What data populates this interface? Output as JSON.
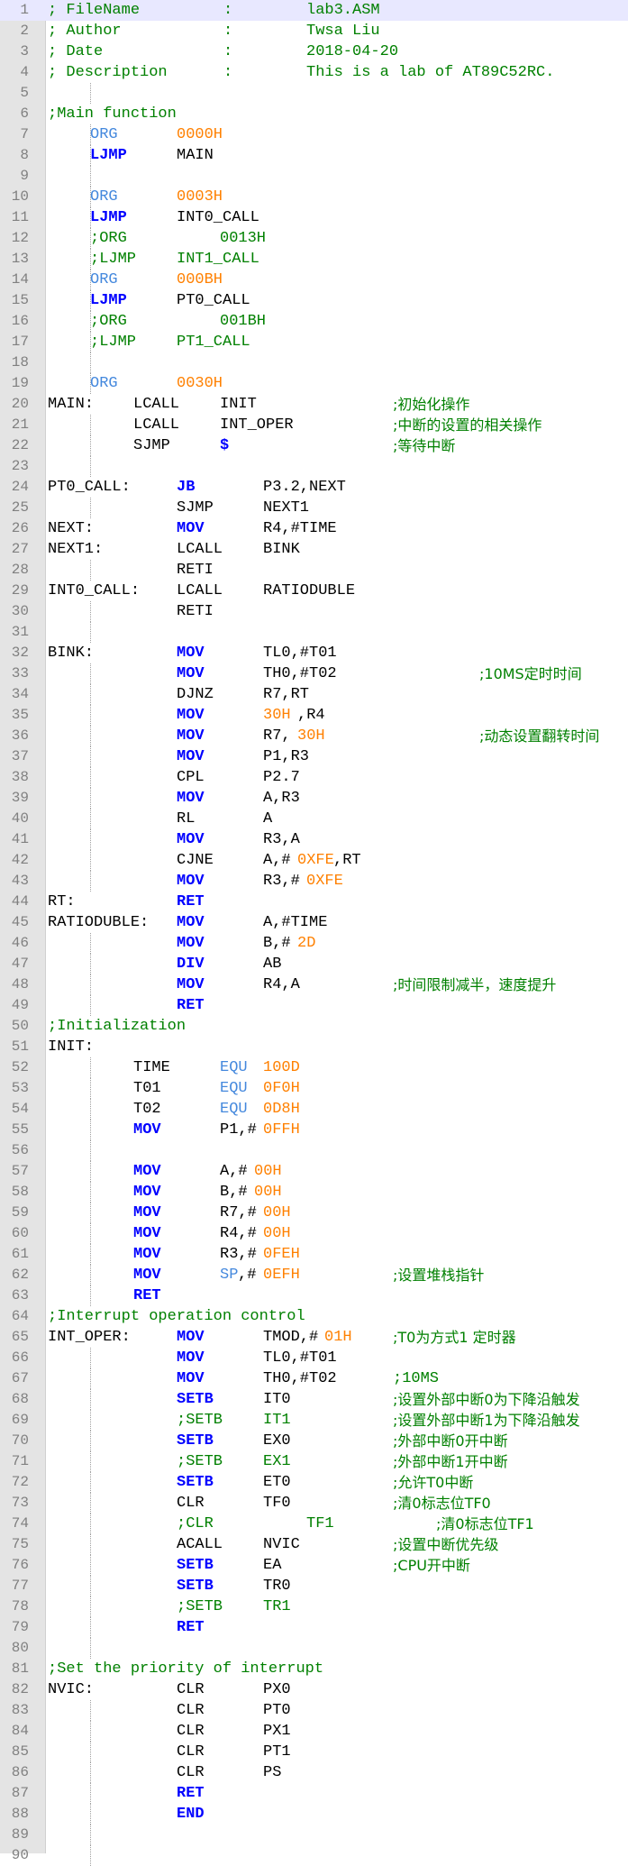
{
  "file": {
    "lines": [
      [
        [
          "com",
          53,
          "; FileName"
        ],
        [
          "com",
          248,
          ":"
        ],
        [
          "com",
          340,
          "lab3.ASM"
        ]
      ],
      [
        [
          "com",
          53,
          "; Author"
        ],
        [
          "com",
          248,
          ":"
        ],
        [
          "com",
          340,
          "Twsa Liu"
        ]
      ],
      [
        [
          "com",
          53,
          "; Date"
        ],
        [
          "com",
          248,
          ":"
        ],
        [
          "com",
          340,
          "2018-04-20"
        ]
      ],
      [
        [
          "com",
          53,
          "; Description"
        ],
        [
          "com",
          248,
          ":"
        ],
        [
          "com",
          340,
          "This is a lab of AT89C52RC."
        ]
      ],
      [],
      [
        [
          "com",
          53,
          ";Main function"
        ]
      ],
      [
        [
          "dir",
          100,
          "ORG"
        ],
        [
          "num",
          196,
          "0000H"
        ]
      ],
      [
        [
          "kw",
          100,
          "LJMP"
        ],
        [
          "txt",
          196,
          "MAIN"
        ]
      ],
      [],
      [
        [
          "dir",
          100,
          "ORG"
        ],
        [
          "num",
          196,
          "0003H"
        ]
      ],
      [
        [
          "kw",
          100,
          "LJMP"
        ],
        [
          "txt",
          196,
          "INT0_CALL"
        ]
      ],
      [
        [
          "com",
          100,
          ";ORG"
        ],
        [
          "com",
          244,
          "0013H"
        ]
      ],
      [
        [
          "com",
          100,
          ";LJMP"
        ],
        [
          "com",
          196,
          "INT1_CALL"
        ]
      ],
      [
        [
          "dir",
          100,
          "ORG"
        ],
        [
          "num",
          196,
          "000BH"
        ]
      ],
      [
        [
          "kw",
          100,
          "LJMP"
        ],
        [
          "txt",
          196,
          "PT0_CALL"
        ]
      ],
      [
        [
          "com",
          100,
          ";ORG"
        ],
        [
          "com",
          244,
          "001BH"
        ]
      ],
      [
        [
          "com",
          100,
          ";LJMP"
        ],
        [
          "com",
          196,
          "PT1_CALL"
        ]
      ],
      [],
      [
        [
          "dir",
          100,
          "ORG"
        ],
        [
          "num",
          196,
          "0030H"
        ]
      ],
      [
        [
          "txt",
          53,
          "MAIN:"
        ],
        [
          "txt",
          148,
          "LCALL"
        ],
        [
          "txt",
          244,
          "INIT"
        ],
        [
          "com",
          436,
          ";初始化操作"
        ]
      ],
      [
        [
          "txt",
          148,
          "LCALL"
        ],
        [
          "txt",
          244,
          "INT_OPER"
        ],
        [
          "com",
          436,
          ";中断的设置的相关操作"
        ]
      ],
      [
        [
          "txt",
          148,
          "SJMP"
        ],
        [
          "kw",
          244,
          "$"
        ],
        [
          "com",
          436,
          ";等待中断"
        ]
      ],
      [],
      [
        [
          "txt",
          53,
          "PT0_CALL:"
        ],
        [
          "kw",
          196,
          "JB"
        ],
        [
          "txt",
          292,
          "P3.2,NEXT"
        ]
      ],
      [
        [
          "txt",
          196,
          "SJMP"
        ],
        [
          "txt",
          292,
          "NEXT1"
        ]
      ],
      [
        [
          "txt",
          53,
          "NEXT:"
        ],
        [
          "kw",
          196,
          "MOV"
        ],
        [
          "txt",
          292,
          "R4,#TIME"
        ]
      ],
      [
        [
          "txt",
          53,
          "NEXT1:"
        ],
        [
          "txt",
          196,
          "LCALL"
        ],
        [
          "txt",
          292,
          "BINK"
        ]
      ],
      [
        [
          "txt",
          196,
          "RETI"
        ]
      ],
      [
        [
          "txt",
          53,
          "INT0_CALL:"
        ],
        [
          "txt",
          196,
          "LCALL"
        ],
        [
          "txt",
          292,
          "RATIODUBLE"
        ]
      ],
      [
        [
          "txt",
          196,
          "RETI"
        ]
      ],
      [],
      [
        [
          "txt",
          53,
          "BINK:"
        ],
        [
          "kw",
          196,
          "MOV"
        ],
        [
          "txt",
          292,
          "TL0,#T01"
        ]
      ],
      [
        [
          "kw",
          196,
          "MOV"
        ],
        [
          "txt",
          292,
          "TH0,#T02"
        ],
        [
          "com",
          532,
          ";10MS定时时间"
        ]
      ],
      [
        [
          "txt",
          196,
          "DJNZ"
        ],
        [
          "txt",
          292,
          "R7,RT"
        ]
      ],
      [
        [
          "kw",
          196,
          "MOV"
        ],
        [
          "num",
          292,
          "30H"
        ],
        [
          "txt",
          330,
          ",R4"
        ]
      ],
      [
        [
          "kw",
          196,
          "MOV"
        ],
        [
          "txt",
          292,
          "R7,"
        ],
        [
          "num",
          330,
          "30H"
        ],
        [
          "com",
          532,
          ";动态设置翻转时间"
        ]
      ],
      [
        [
          "kw",
          196,
          "MOV"
        ],
        [
          "txt",
          292,
          "P1,R3"
        ]
      ],
      [
        [
          "txt",
          196,
          "CPL"
        ],
        [
          "txt",
          292,
          "P2.7"
        ]
      ],
      [
        [
          "kw",
          196,
          "MOV"
        ],
        [
          "txt",
          292,
          "A,R3"
        ]
      ],
      [
        [
          "txt",
          196,
          "RL"
        ],
        [
          "txt",
          292,
          "A"
        ]
      ],
      [
        [
          "kw",
          196,
          "MOV"
        ],
        [
          "txt",
          292,
          "R3,A"
        ]
      ],
      [
        [
          "txt",
          196,
          "CJNE"
        ],
        [
          "txt",
          292,
          "A,#"
        ],
        [
          "num",
          330,
          "0XFE"
        ],
        [
          "txt",
          370,
          ",RT"
        ]
      ],
      [
        [
          "kw",
          196,
          "MOV"
        ],
        [
          "txt",
          292,
          "R3,#"
        ],
        [
          "num",
          340,
          "0XFE"
        ]
      ],
      [
        [
          "txt",
          53,
          "RT:"
        ],
        [
          "kw",
          196,
          "RET"
        ]
      ],
      [
        [
          "txt",
          53,
          "RATIODUBLE:"
        ],
        [
          "kw",
          196,
          "MOV"
        ],
        [
          "txt",
          292,
          "A,#TIME"
        ]
      ],
      [
        [
          "kw",
          196,
          "MOV"
        ],
        [
          "txt",
          292,
          "B,#"
        ],
        [
          "num",
          330,
          "2D"
        ]
      ],
      [
        [
          "kw",
          196,
          "DIV"
        ],
        [
          "txt",
          292,
          "AB"
        ]
      ],
      [
        [
          "kw",
          196,
          "MOV"
        ],
        [
          "txt",
          292,
          "R4,A"
        ],
        [
          "com",
          436,
          ";时间限制减半，速度提升"
        ]
      ],
      [
        [
          "kw",
          196,
          "RET"
        ]
      ],
      [
        [
          "com",
          53,
          ";Initialization"
        ]
      ],
      [
        [
          "txt",
          53,
          "INIT:"
        ]
      ],
      [
        [
          "txt",
          148,
          "TIME"
        ],
        [
          "dir",
          244,
          "EQU"
        ],
        [
          "num",
          292,
          "100D"
        ]
      ],
      [
        [
          "txt",
          148,
          "T01"
        ],
        [
          "dir",
          244,
          "EQU"
        ],
        [
          "num",
          292,
          "0F0H"
        ]
      ],
      [
        [
          "txt",
          148,
          "T02"
        ],
        [
          "dir",
          244,
          "EQU"
        ],
        [
          "num",
          292,
          "0D8H"
        ]
      ],
      [
        [
          "kw",
          148,
          "MOV"
        ],
        [
          "txt",
          244,
          "P1,#"
        ],
        [
          "num",
          292,
          "0FFH"
        ]
      ],
      [],
      [
        [
          "kw",
          148,
          "MOV"
        ],
        [
          "txt",
          244,
          "A,#"
        ],
        [
          "num",
          282,
          "00H"
        ]
      ],
      [
        [
          "kw",
          148,
          "MOV"
        ],
        [
          "txt",
          244,
          "B,#"
        ],
        [
          "num",
          282,
          "00H"
        ]
      ],
      [
        [
          "kw",
          148,
          "MOV"
        ],
        [
          "txt",
          244,
          "R7,#"
        ],
        [
          "num",
          292,
          "00H"
        ]
      ],
      [
        [
          "kw",
          148,
          "MOV"
        ],
        [
          "txt",
          244,
          "R4,#"
        ],
        [
          "num",
          292,
          "00H"
        ]
      ],
      [
        [
          "kw",
          148,
          "MOV"
        ],
        [
          "txt",
          244,
          "R3,#"
        ],
        [
          "num",
          292,
          "0FEH"
        ]
      ],
      [
        [
          "kw",
          148,
          "MOV"
        ],
        [
          "dir",
          244,
          "SP"
        ],
        [
          "txt",
          264,
          ",#"
        ],
        [
          "num",
          292,
          "0EFH"
        ],
        [
          "com",
          436,
          ";设置堆栈指针"
        ]
      ],
      [
        [
          "kw",
          148,
          "RET"
        ]
      ],
      [
        [
          "com",
          53,
          ";Interrupt operation control"
        ]
      ],
      [
        [
          "txt",
          53,
          "INT_OPER:"
        ],
        [
          "kw",
          196,
          "MOV"
        ],
        [
          "txt",
          292,
          "TMOD,#"
        ],
        [
          "num",
          360,
          "01H"
        ],
        [
          "com",
          436,
          ";T0为方式1 定时器"
        ]
      ],
      [
        [
          "kw",
          196,
          "MOV"
        ],
        [
          "txt",
          292,
          "TL0,#T01"
        ]
      ],
      [
        [
          "kw",
          196,
          "MOV"
        ],
        [
          "txt",
          292,
          "TH0,#T02"
        ],
        [
          "com",
          436,
          ";10MS"
        ]
      ],
      [
        [
          "kw",
          196,
          "SETB"
        ],
        [
          "txt",
          292,
          "IT0"
        ],
        [
          "com",
          436,
          ";设置外部中断0为下降沿触发"
        ]
      ],
      [
        [
          "com",
          196,
          ";SETB"
        ],
        [
          "com",
          292,
          "IT1"
        ],
        [
          "com",
          436,
          ";设置外部中断1为下降沿触发"
        ]
      ],
      [
        [
          "kw",
          196,
          "SETB"
        ],
        [
          "txt",
          292,
          "EX0"
        ],
        [
          "com",
          436,
          ";外部中断0开中断"
        ]
      ],
      [
        [
          "com",
          196,
          ";SETB"
        ],
        [
          "com",
          292,
          "EX1"
        ],
        [
          "com",
          436,
          ";外部中断1开中断"
        ]
      ],
      [
        [
          "kw",
          196,
          "SETB"
        ],
        [
          "txt",
          292,
          "ET0"
        ],
        [
          "com",
          436,
          ";允许T0中断"
        ]
      ],
      [
        [
          "txt",
          196,
          "CLR"
        ],
        [
          "txt",
          292,
          "TF0"
        ],
        [
          "com",
          436,
          ";清0标志位TF0"
        ]
      ],
      [
        [
          "com",
          196,
          ";CLR"
        ],
        [
          "com",
          340,
          "TF1"
        ],
        [
          "com",
          484,
          ";清0标志位TF1"
        ]
      ],
      [
        [
          "txt",
          196,
          "ACALL"
        ],
        [
          "txt",
          292,
          "NVIC"
        ],
        [
          "com",
          436,
          ";设置中断优先级"
        ]
      ],
      [
        [
          "kw",
          196,
          "SETB"
        ],
        [
          "txt",
          292,
          "EA"
        ],
        [
          "com",
          436,
          ";CPU开中断"
        ]
      ],
      [
        [
          "kw",
          196,
          "SETB"
        ],
        [
          "txt",
          292,
          "TR0"
        ]
      ],
      [
        [
          "com",
          196,
          ";SETB"
        ],
        [
          "com",
          292,
          "TR1"
        ]
      ],
      [
        [
          "kw",
          196,
          "RET"
        ]
      ],
      [],
      [
        [
          "com",
          53,
          ";Set the priority of interrupt"
        ]
      ],
      [
        [
          "txt",
          53,
          "NVIC:"
        ],
        [
          "txt",
          196,
          "CLR"
        ],
        [
          "txt",
          292,
          "PX0"
        ]
      ],
      [
        [
          "txt",
          196,
          "CLR"
        ],
        [
          "txt",
          292,
          "PT0"
        ]
      ],
      [
        [
          "txt",
          196,
          "CLR"
        ],
        [
          "txt",
          292,
          "PX1"
        ]
      ],
      [
        [
          "txt",
          196,
          "CLR"
        ],
        [
          "txt",
          292,
          "PT1"
        ]
      ],
      [
        [
          "txt",
          196,
          "CLR"
        ],
        [
          "txt",
          292,
          "PS"
        ]
      ],
      [
        [
          "kw",
          196,
          "RET"
        ]
      ],
      [
        [
          "kw",
          196,
          "END"
        ]
      ],
      [],
      []
    ]
  }
}
